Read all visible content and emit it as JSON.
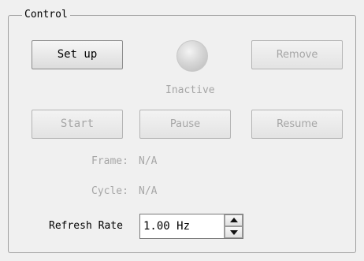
{
  "control_group": {
    "title": "Control"
  },
  "buttons": {
    "setup": "Set up",
    "remove": "Remove",
    "start": "Start",
    "pause": "Pause",
    "resume": "Resume"
  },
  "status": {
    "text": "Inactive",
    "indicator_color": "#c9c9c9"
  },
  "frame": {
    "label": "Frame:",
    "value": "N/A"
  },
  "cycle": {
    "label": "Cycle:",
    "value": "N/A"
  },
  "refresh_rate": {
    "label": "Refresh Rate",
    "value": "1.00 Hz"
  },
  "icons": {
    "spin_up": "triangle-up",
    "spin_down": "triangle-down",
    "status_indicator": "led"
  }
}
